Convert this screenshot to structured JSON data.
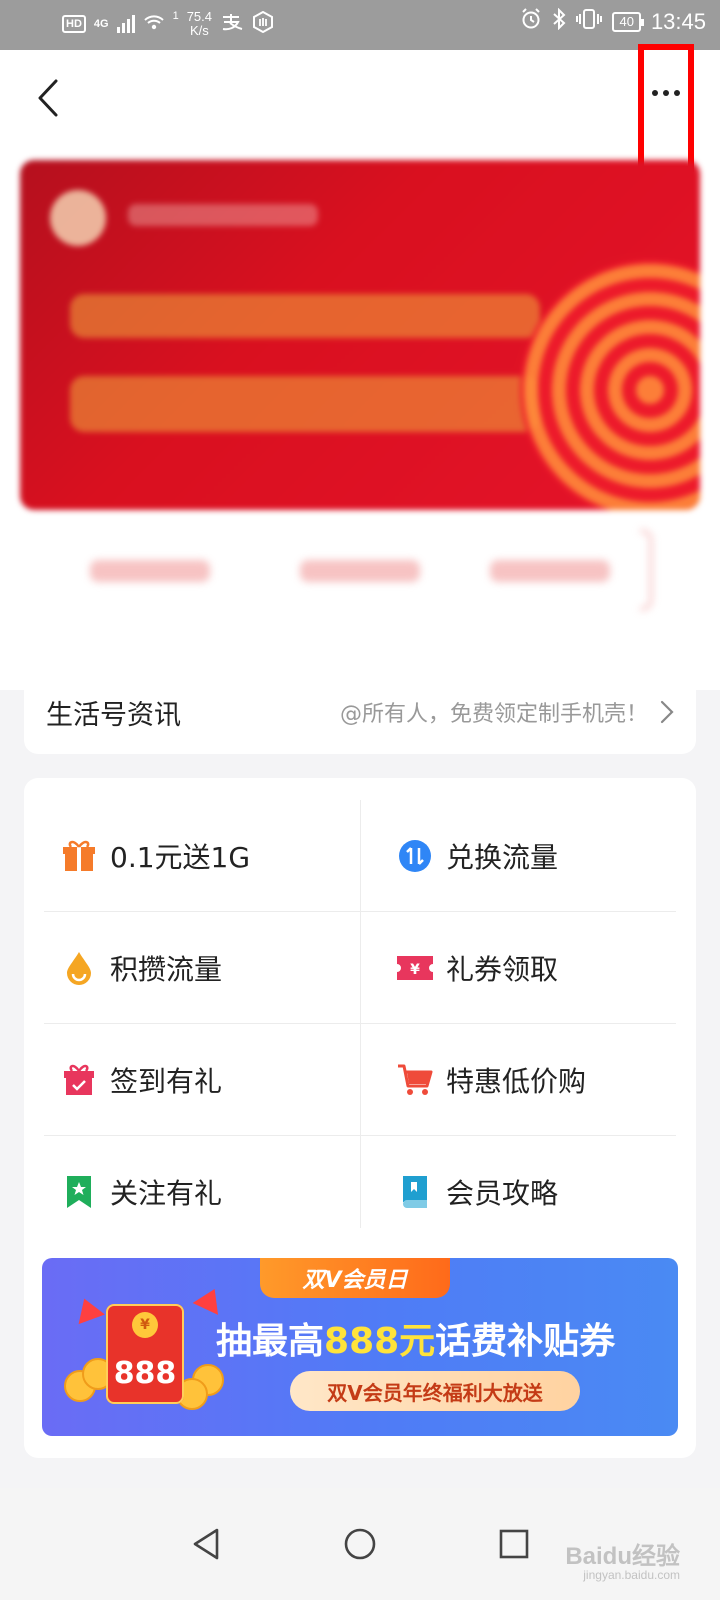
{
  "status_bar": {
    "hd_label": "HD",
    "network_label": "4G",
    "sim_index": "1",
    "speed_value": "75.4",
    "speed_unit": "K/s",
    "battery_level": "40",
    "time": "13:45"
  },
  "header": {
    "back_icon": "chevron-left-icon",
    "more_icon": "more-dots-icon",
    "highlight_color": "#ff0000"
  },
  "news": {
    "title": "生活号资讯",
    "text": "@所有人，免费领定制手机壳！"
  },
  "grid": {
    "items": [
      {
        "label": "0.1元送1G",
        "icon": "gift-icon",
        "color": "#f57b2a"
      },
      {
        "label": "兑换流量",
        "icon": "exchange-icon",
        "color": "#2f86f6"
      },
      {
        "label": "积攒流量",
        "icon": "droplet-icon",
        "color": "#f5a623"
      },
      {
        "label": "礼券领取",
        "icon": "coupon-icon",
        "color": "#e8365d"
      },
      {
        "label": "签到有礼",
        "icon": "checkin-gift-icon",
        "color": "#e8365d"
      },
      {
        "label": "特惠低价购",
        "icon": "cart-icon",
        "color": "#ef4b3a"
      },
      {
        "label": "关注有礼",
        "icon": "bookmark-star-icon",
        "color": "#1fae5b"
      },
      {
        "label": "会员攻略",
        "icon": "book-icon",
        "color": "#1f9fd0"
      }
    ]
  },
  "promo": {
    "tag": "双V会员日",
    "title_prefix": "抽最高",
    "title_highlight": "888元",
    "title_suffix": "话费补贴券",
    "subtitle": "双V会员年终福利大放送",
    "envelope_number": "888",
    "coin_symbol": "¥"
  },
  "nav": {
    "back_icon": "triangle-back-icon",
    "home_icon": "circle-home-icon",
    "recents_icon": "square-recents-icon"
  },
  "watermark": {
    "brand": "Baidu经验",
    "url": "jingyan.baidu.com"
  }
}
